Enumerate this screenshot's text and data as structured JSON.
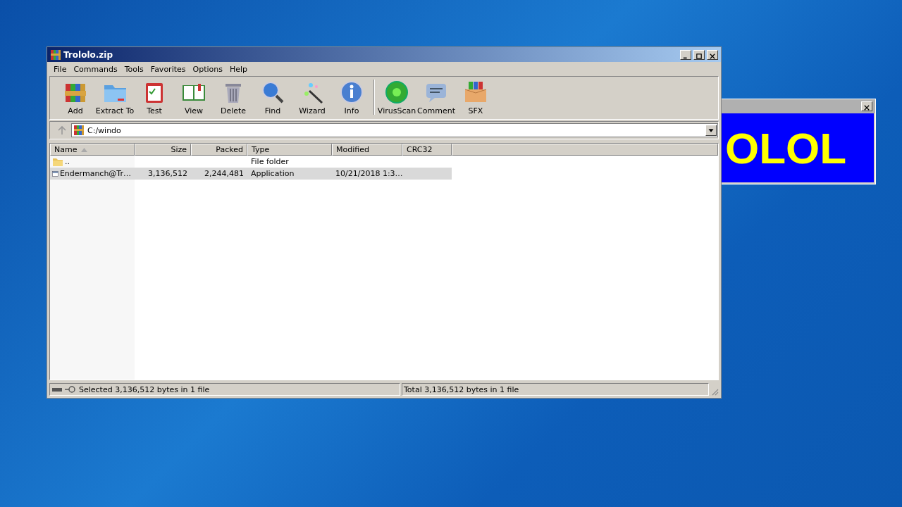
{
  "window": {
    "title": "Trololo.zip"
  },
  "menu": [
    "File",
    "Commands",
    "Tools",
    "Favorites",
    "Options",
    "Help"
  ],
  "toolbar": [
    {
      "label": "Add",
      "kind": "add"
    },
    {
      "label": "Extract To",
      "kind": "extract"
    },
    {
      "label": "Test",
      "kind": "test"
    },
    {
      "label": "View",
      "kind": "view"
    },
    {
      "label": "Delete",
      "kind": "delete"
    },
    {
      "label": "Find",
      "kind": "find"
    },
    {
      "label": "Wizard",
      "kind": "wizard"
    },
    {
      "label": "Info",
      "kind": "info"
    },
    {
      "label": "VirusScan",
      "kind": "virus"
    },
    {
      "label": "Comment",
      "kind": "comment"
    },
    {
      "label": "SFX",
      "kind": "sfx"
    }
  ],
  "address": {
    "value": "C:/windo"
  },
  "table": {
    "columns": [
      {
        "label": "Name",
        "sorted": true
      },
      {
        "label": "Size",
        "sorted": false
      },
      {
        "label": "Packed",
        "sorted": false
      },
      {
        "label": "Type",
        "sorted": false
      },
      {
        "label": "Modified",
        "sorted": false
      },
      {
        "label": "CRC32",
        "sorted": false
      }
    ],
    "rows": [
      {
        "kind": "folder",
        "selected": false,
        "cells": [
          "..",
          "",
          "",
          "File folder",
          "",
          ""
        ]
      },
      {
        "kind": "app",
        "selected": true,
        "cells": [
          "Endermanch@Tr…",
          "3,136,512",
          "2,244,481",
          "Application",
          "10/21/2018 1:3…",
          ""
        ]
      }
    ]
  },
  "status_bar": [
    "Selected 3,136,512 bytes in 1 file",
    "Total 3,136,512 bytes in 1 file"
  ],
  "popup": {
    "text": "OLOL"
  }
}
